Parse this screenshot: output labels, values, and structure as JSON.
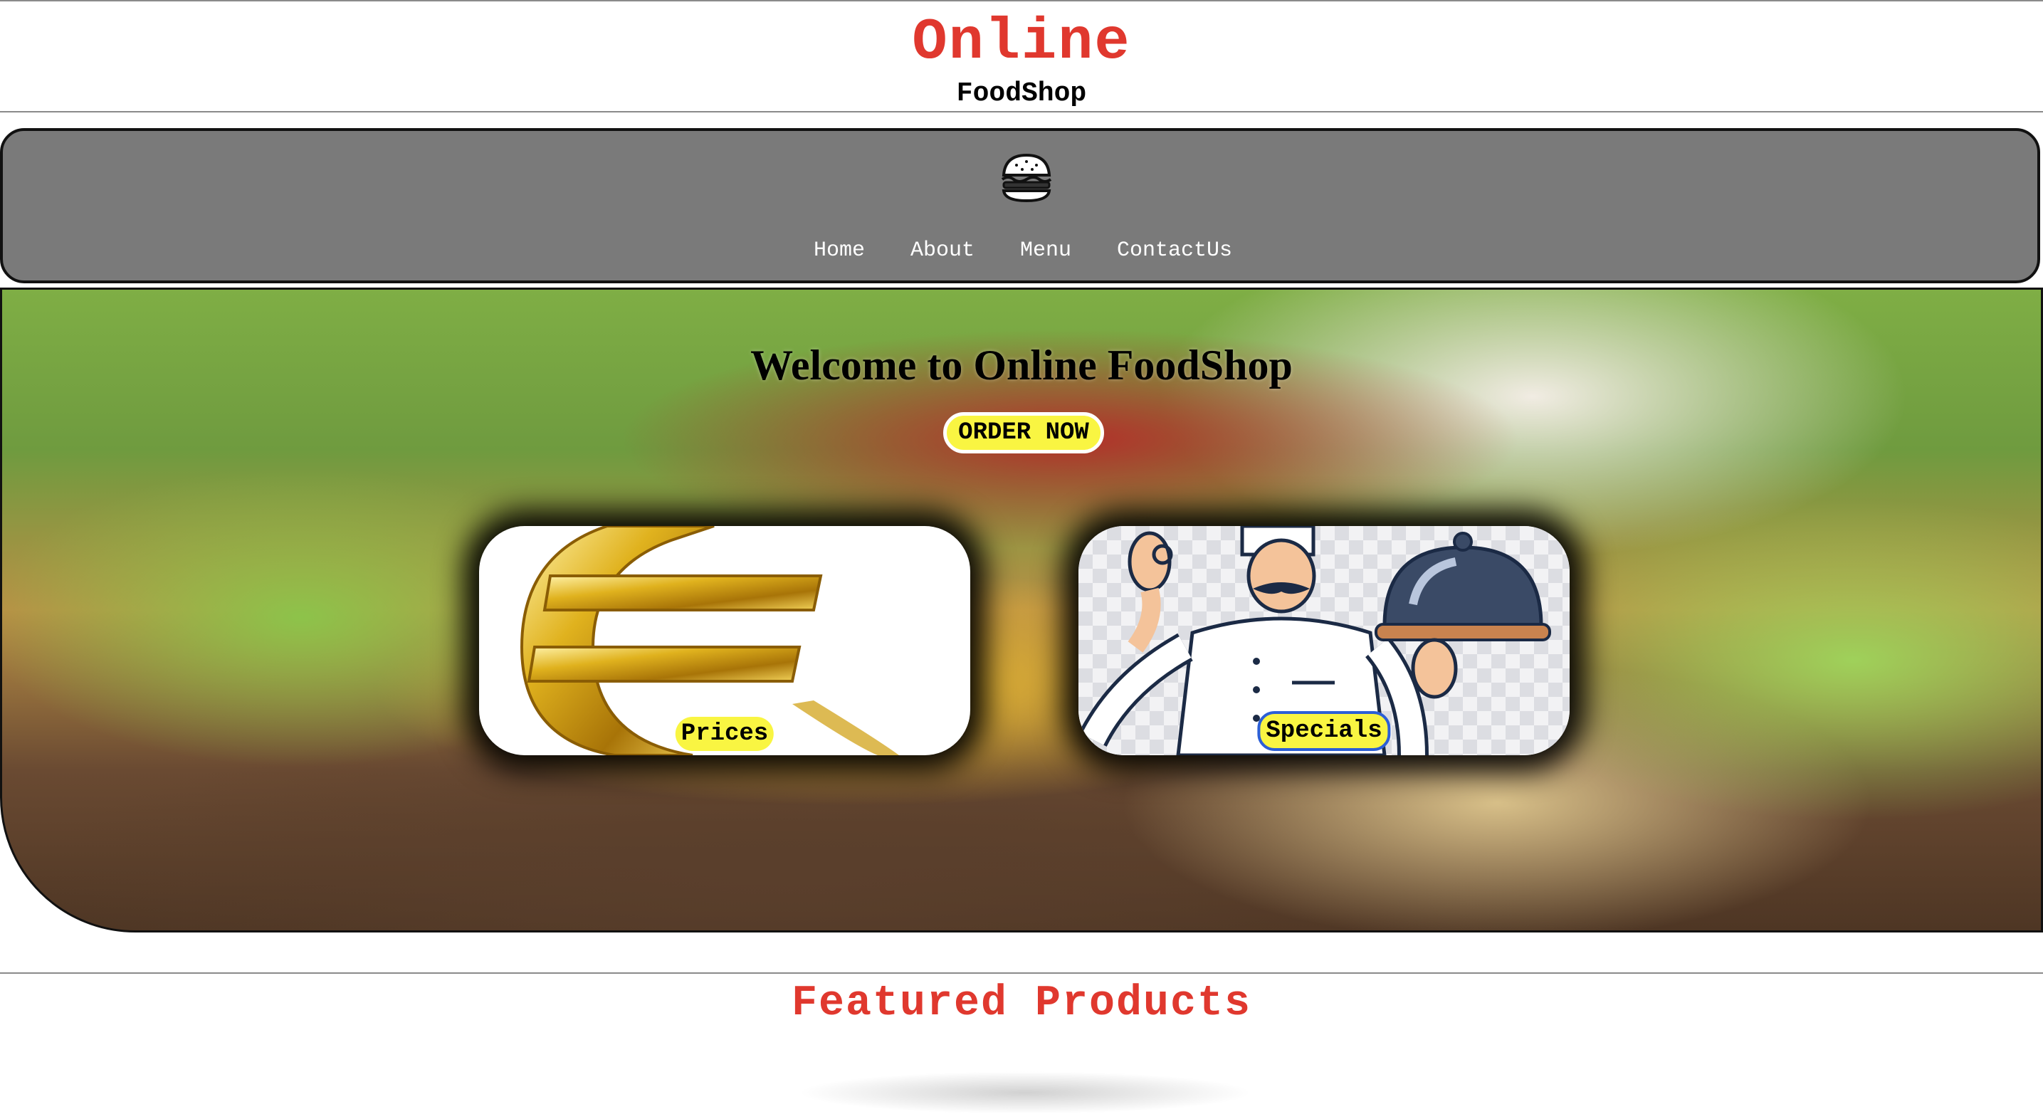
{
  "header": {
    "title": "Online",
    "subtitle": "FoodShop"
  },
  "nav": {
    "logo_icon": "burger-icon",
    "links": [
      "Home",
      "About",
      "Menu",
      "ContactUs"
    ]
  },
  "hero": {
    "background": "burger-photo",
    "title": "Welcome to Online FoodShop",
    "order_button": "ORDER NOW",
    "cards": [
      {
        "label": "Prices",
        "image": "euro-sign-image"
      },
      {
        "label": "Specials",
        "image": "chef-with-cloche-image"
      }
    ]
  },
  "featured": {
    "title": "Featured Products"
  },
  "colors": {
    "accent_red": "#e0382e",
    "nav_gray": "#7a7a7a",
    "button_yellow": "#f9f542"
  }
}
